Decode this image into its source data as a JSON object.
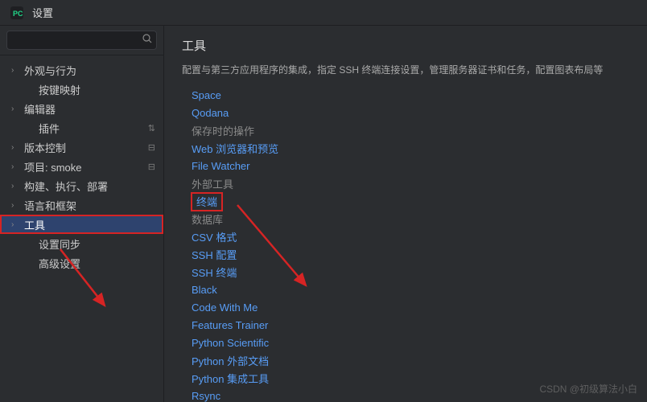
{
  "titlebar": {
    "title": "设置"
  },
  "search": {
    "placeholder": ""
  },
  "sidebar": {
    "items": [
      {
        "label": "外观与行为",
        "expandable": true,
        "child": false
      },
      {
        "label": "按键映射",
        "expandable": false,
        "child": true
      },
      {
        "label": "编辑器",
        "expandable": true,
        "child": false
      },
      {
        "label": "插件",
        "expandable": false,
        "child": true,
        "badge": "⇅"
      },
      {
        "label": "版本控制",
        "expandable": true,
        "child": false,
        "badge": "⊟"
      },
      {
        "label": "项目: smoke",
        "expandable": true,
        "child": false,
        "badge": "⊟"
      },
      {
        "label": "构建、执行、部署",
        "expandable": true,
        "child": false
      },
      {
        "label": "语言和框架",
        "expandable": true,
        "child": false
      },
      {
        "label": "工具",
        "expandable": true,
        "child": false,
        "selected": true,
        "highlight": true
      },
      {
        "label": "设置同步",
        "expandable": false,
        "child": true
      },
      {
        "label": "高级设置",
        "expandable": false,
        "child": true
      }
    ]
  },
  "content": {
    "title": "工具",
    "desc": "配置与第三方应用程序的集成，指定 SSH 终端连接设置，管理服务器证书和任务，配置图表布局等",
    "links": [
      {
        "label": "Space"
      },
      {
        "label": "Qodana"
      },
      {
        "label": "保存时的操作",
        "gray": true
      },
      {
        "label": "Web 浏览器和预览"
      },
      {
        "label": "File Watcher"
      },
      {
        "label": "外部工具",
        "gray": true
      },
      {
        "label": "终端",
        "highlight": true
      },
      {
        "label": "数据库",
        "gray": true
      },
      {
        "label": "CSV 格式"
      },
      {
        "label": "SSH 配置"
      },
      {
        "label": "SSH 终端"
      },
      {
        "label": "Black"
      },
      {
        "label": "Code With Me"
      },
      {
        "label": "Features Trainer"
      },
      {
        "label": "Python Scientific"
      },
      {
        "label": "Python 外部文档"
      },
      {
        "label": "Python 集成工具"
      },
      {
        "label": "Rsync"
      }
    ]
  },
  "watermark": "CSDN @初级算法小白"
}
